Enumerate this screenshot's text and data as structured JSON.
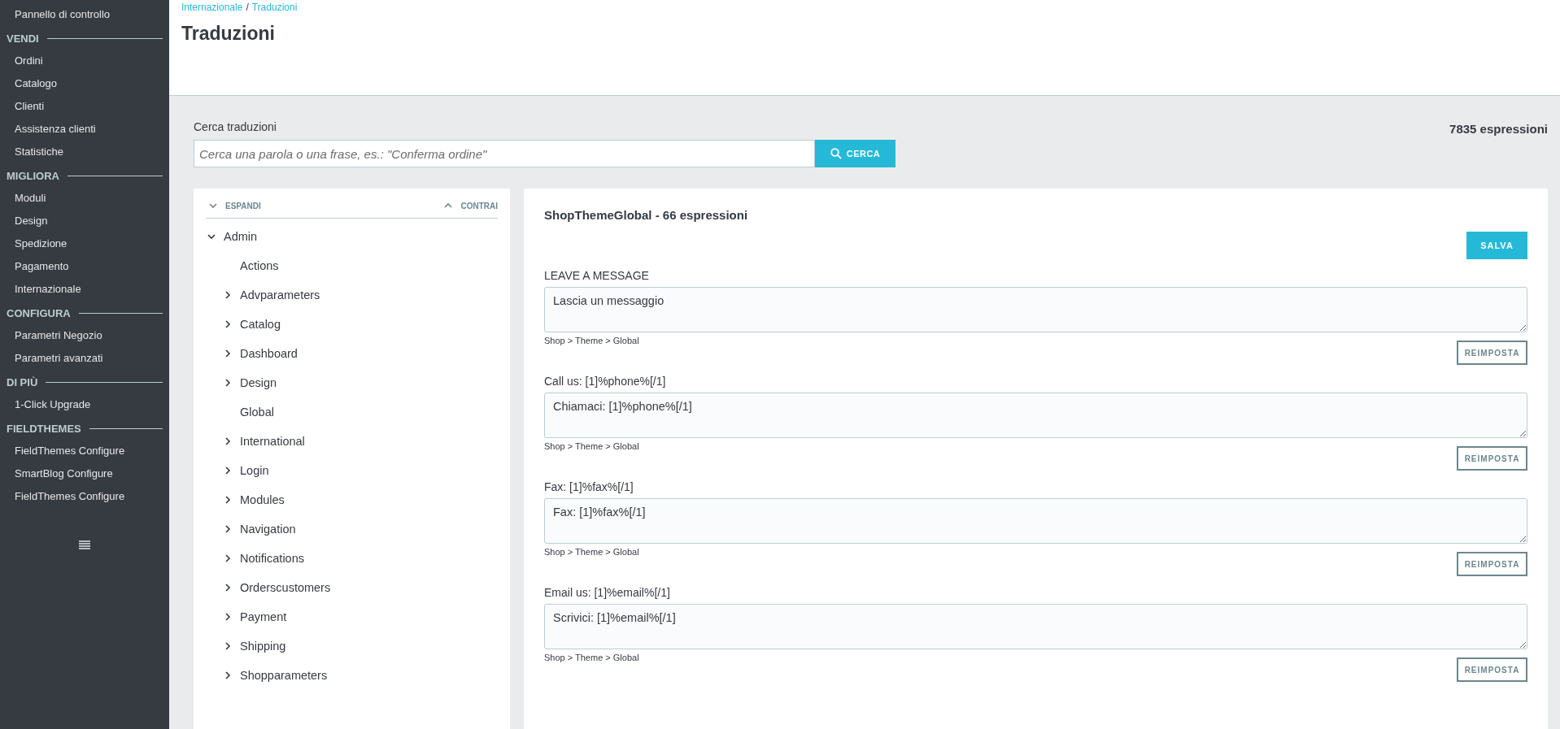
{
  "sidebar": {
    "top_item": "Pannello di controllo",
    "sections": [
      {
        "title": "VENDI",
        "items": [
          "Ordini",
          "Catalogo",
          "Clienti",
          "Assistenza clienti",
          "Statistiche"
        ]
      },
      {
        "title": "MIGLIORA",
        "items": [
          "Moduli",
          "Design",
          "Spedizione",
          "Pagamento",
          "Internazionale"
        ]
      },
      {
        "title": "CONFIGURA",
        "items": [
          "Parametri Negozio",
          "Parametri avanzati"
        ]
      },
      {
        "title": "DI PIÙ",
        "items": [
          "1-Click Upgrade"
        ]
      },
      {
        "title": "FIELDTHEMES",
        "items": [
          "FieldThemes Configure",
          "SmartBlog Configure",
          "FieldThemes Configure"
        ]
      }
    ]
  },
  "breadcrumb": [
    "Internazionale",
    "Traduzioni"
  ],
  "breadcrumb_separator": "/",
  "page_title": "Traduzioni",
  "search": {
    "label": "Cerca traduzioni",
    "placeholder": "Cerca una parola o una frase, es.: \"Conferma ordine\"",
    "button": "CERCA"
  },
  "total_count": "7835 espressioni",
  "tree": {
    "expand_all": "ESPANDI",
    "collapse_all": "CONTRAI",
    "nodes": [
      {
        "label": "Admin",
        "kind": "folder",
        "expanded": true,
        "children": [
          {
            "label": "Actions",
            "kind": "leaf"
          },
          {
            "label": "Advparameters",
            "kind": "folder",
            "expanded": false
          },
          {
            "label": "Catalog",
            "kind": "folder",
            "expanded": false
          },
          {
            "label": "Dashboard",
            "kind": "folder",
            "expanded": false
          },
          {
            "label": "Design",
            "kind": "folder",
            "expanded": false
          },
          {
            "label": "Global",
            "kind": "leaf"
          },
          {
            "label": "International",
            "kind": "folder",
            "expanded": false
          },
          {
            "label": "Login",
            "kind": "folder",
            "expanded": false
          },
          {
            "label": "Modules",
            "kind": "folder",
            "expanded": false
          },
          {
            "label": "Navigation",
            "kind": "folder",
            "expanded": false
          },
          {
            "label": "Notifications",
            "kind": "folder",
            "expanded": false
          },
          {
            "label": "Orderscustomers",
            "kind": "folder",
            "expanded": false
          },
          {
            "label": "Payment",
            "kind": "folder",
            "expanded": false
          },
          {
            "label": "Shipping",
            "kind": "folder",
            "expanded": false
          },
          {
            "label": "Shopparameters",
            "kind": "folder",
            "expanded": false
          }
        ]
      }
    ]
  },
  "editor": {
    "title": "ShopThemeGlobal - 66 espressioni",
    "save_button": "SALVA",
    "entries": [
      {
        "source": "LEAVE A MESSAGE",
        "translation": "Lascia un messaggio",
        "domain": "Shop > Theme > Global",
        "reset_button": "REIMPOSTA"
      },
      {
        "source": "Call us: [1]%phone%[/1]",
        "translation": "Chiamaci: [1]%phone%[/1]",
        "domain": "Shop > Theme > Global",
        "reset_button": "REIMPOSTA"
      },
      {
        "source": "Fax: [1]%fax%[/1]",
        "translation": "Fax: [1]%fax%[/1]",
        "domain": "Shop > Theme > Global",
        "reset_button": "REIMPOSTA"
      },
      {
        "source": "Email us: [1]%email%[/1]",
        "translation": "Scrivici: [1]%email%[/1]",
        "domain": "Shop > Theme > Global",
        "reset_button": "REIMPOSTA"
      }
    ]
  }
}
